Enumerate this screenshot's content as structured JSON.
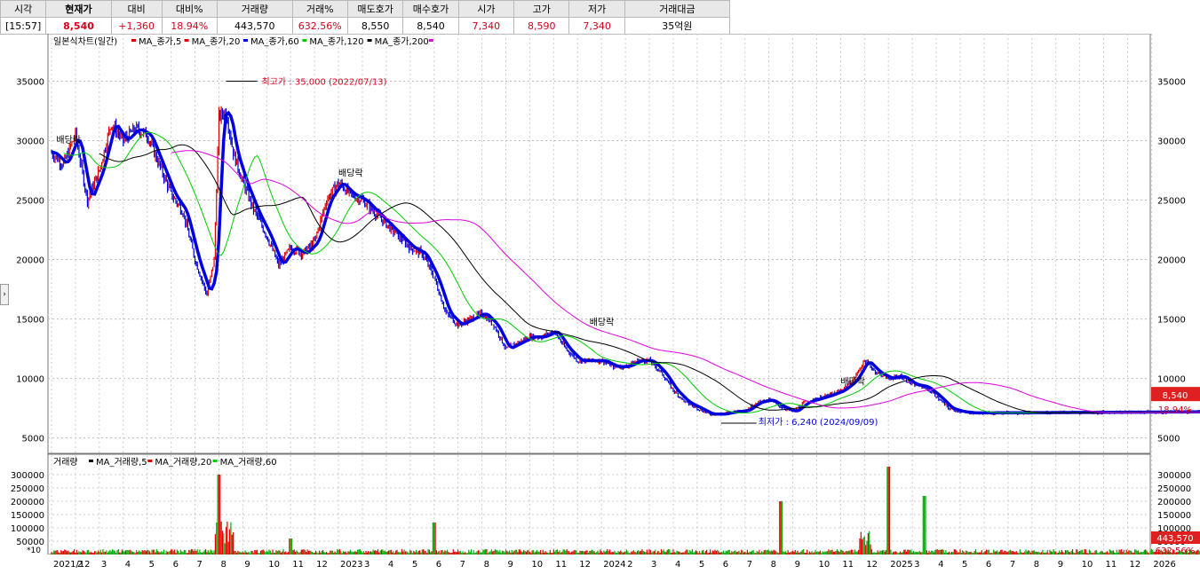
{
  "quote": {
    "headers": [
      "시각",
      "현재가",
      "대비",
      "대비%",
      "거래량",
      "거래%",
      "매도호가",
      "매수호가",
      "시가",
      "고가",
      "저가",
      "거래대금"
    ],
    "values": [
      "[15:57]",
      "8,540",
      "+1,360",
      "18.94%",
      "443,570",
      "632.56%",
      "8,550",
      "8,540",
      "7,340",
      "8,590",
      "7,340",
      "35억원"
    ]
  },
  "legend": {
    "price_title": "일본식차트(일간)",
    "price_mas": [
      {
        "label": "MA_종가,5",
        "color": "#e00000"
      },
      {
        "label": "MA_종가,20",
        "color": "#e00000"
      },
      {
        "label": "MA_종가,60",
        "color": "#0000dd"
      },
      {
        "label": "MA_종가,120",
        "color": "#00cc00"
      },
      {
        "label": "MA_종가,200",
        "color": "#000000"
      }
    ],
    "price_extra_color": "#e000e0",
    "volume_title": "거래량",
    "volume_mas": [
      {
        "label": "MA_거래량,5",
        "color": "#000000"
      },
      {
        "label": "MA_거래량,20",
        "color": "#e00000"
      },
      {
        "label": "MA_거래량,60",
        "color": "#00cc00"
      }
    ],
    "volume_unit": "*10"
  },
  "annotations": {
    "high": "최고가 : 35,000 (2022/07/13)",
    "low": "최저가 : 6,240 (2024/09/09)",
    "dividends": [
      "배당락",
      "배당락",
      "배당락",
      "배당락",
      "배당락"
    ]
  },
  "current_price_badge": {
    "price": "8,540",
    "change": "18.94%"
  },
  "current_volume_badge": {
    "volume": "443,570",
    "ratio": "632.56%"
  },
  "chart_data": {
    "type": "line",
    "price_axis": {
      "ticks": [
        "35000",
        "30000",
        "25000",
        "20000",
        "15000",
        "10000",
        "5000"
      ],
      "ylim": [
        4000,
        37500
      ]
    },
    "volume_axis": {
      "ticks": [
        "300000",
        "250000",
        "200000",
        "150000",
        "100000",
        "50000"
      ],
      "ylim": [
        0,
        350000
      ]
    },
    "x_labels": [
      "2021/12",
      "2",
      "3",
      "4",
      "5",
      "6",
      "7",
      "8",
      "9",
      "10",
      "11",
      "12",
      "2023",
      "3",
      "4",
      "5",
      "6",
      "7",
      "8",
      "9",
      "10",
      "11",
      "12",
      "2024",
      "2",
      "3",
      "4",
      "5",
      "6",
      "7",
      "8",
      "9",
      "10",
      "11",
      "12",
      "2025",
      "3",
      "4",
      "5",
      "6",
      "7",
      "8",
      "9",
      "10",
      "11",
      "12",
      "2026"
    ],
    "price_series": [
      {
        "m": 0,
        "v": 29000
      },
      {
        "m": 0.5,
        "v": 28000
      },
      {
        "m": 1,
        "v": 30500
      },
      {
        "m": 1.5,
        "v": 25000
      },
      {
        "m": 2,
        "v": 27500
      },
      {
        "m": 2.5,
        "v": 31500
      },
      {
        "m": 3,
        "v": 30000
      },
      {
        "m": 3.5,
        "v": 31000
      },
      {
        "m": 4,
        "v": 30500
      },
      {
        "m": 4.5,
        "v": 28000
      },
      {
        "m": 5,
        "v": 25500
      },
      {
        "m": 5.5,
        "v": 24000
      },
      {
        "m": 6,
        "v": 20000
      },
      {
        "m": 6.5,
        "v": 17000
      },
      {
        "m": 6.8,
        "v": 20000
      },
      {
        "m": 7,
        "v": 32000
      },
      {
        "m": 7.3,
        "v": 32500
      },
      {
        "m": 7.6,
        "v": 29000
      },
      {
        "m": 8,
        "v": 26500
      },
      {
        "m": 8.5,
        "v": 24000
      },
      {
        "m": 9,
        "v": 22000
      },
      {
        "m": 9.5,
        "v": 19500
      },
      {
        "m": 10,
        "v": 21000
      },
      {
        "m": 10.5,
        "v": 20500
      },
      {
        "m": 11,
        "v": 21500
      },
      {
        "m": 11.5,
        "v": 25000
      },
      {
        "m": 12,
        "v": 26500
      },
      {
        "m": 12.5,
        "v": 25500
      },
      {
        "m": 13,
        "v": 25000
      },
      {
        "m": 13.5,
        "v": 24000
      },
      {
        "m": 14,
        "v": 23000
      },
      {
        "m": 14.5,
        "v": 22000
      },
      {
        "m": 15,
        "v": 21000
      },
      {
        "m": 15.5,
        "v": 20500
      },
      {
        "m": 16,
        "v": 18500
      },
      {
        "m": 16.5,
        "v": 15500
      },
      {
        "m": 17,
        "v": 14500
      },
      {
        "m": 17.5,
        "v": 15000
      },
      {
        "m": 18,
        "v": 15500
      },
      {
        "m": 18.5,
        "v": 14500
      },
      {
        "m": 19,
        "v": 12500
      },
      {
        "m": 19.5,
        "v": 13000
      },
      {
        "m": 20,
        "v": 13500
      },
      {
        "m": 20.5,
        "v": 13500
      },
      {
        "m": 21,
        "v": 14000
      },
      {
        "m": 21.5,
        "v": 12500
      },
      {
        "m": 22,
        "v": 11500
      },
      {
        "m": 22.5,
        "v": 11500
      },
      {
        "m": 23,
        "v": 11500
      },
      {
        "m": 23.5,
        "v": 11000
      },
      {
        "m": 24,
        "v": 11000
      },
      {
        "m": 24.5,
        "v": 11500
      },
      {
        "m": 25,
        "v": 11500
      },
      {
        "m": 25.5,
        "v": 10500
      },
      {
        "m": 26,
        "v": 9000
      },
      {
        "m": 26.5,
        "v": 8000
      },
      {
        "m": 27,
        "v": 7500
      },
      {
        "m": 27.5,
        "v": 7000
      },
      {
        "m": 28,
        "v": 7000
      },
      {
        "m": 28.5,
        "v": 7200
      },
      {
        "m": 29,
        "v": 7300
      },
      {
        "m": 29.5,
        "v": 8000
      },
      {
        "m": 30,
        "v": 8200
      },
      {
        "m": 30.5,
        "v": 7600
      },
      {
        "m": 31,
        "v": 7200
      },
      {
        "m": 31.5,
        "v": 8000
      },
      {
        "m": 32,
        "v": 8300
      },
      {
        "m": 32.5,
        "v": 8600
      },
      {
        "m": 33,
        "v": 9000
      },
      {
        "m": 33.5,
        "v": 9800
      },
      {
        "m": 34,
        "v": 11500
      },
      {
        "m": 34.5,
        "v": 10500
      },
      {
        "m": 35,
        "v": 10000
      },
      {
        "m": 35.5,
        "v": 10200
      },
      {
        "m": 36,
        "v": 9500
      },
      {
        "m": 36.5,
        "v": 9300
      },
      {
        "m": 37,
        "v": 8500
      },
      {
        "m": 37.5,
        "v": 7500
      },
      {
        "m": 38,
        "v": 7200
      },
      {
        "m": 38.5,
        "v": 7100
      },
      {
        "m": 49,
        "v": 7200
      },
      {
        "m": 49.1,
        "v": 8540
      }
    ],
    "high": {
      "date": "2022/07/13",
      "value": 35000
    },
    "low": {
      "date": "2024/09/09",
      "value": 6240
    },
    "last": {
      "price": 8540,
      "volume": 443570
    }
  }
}
